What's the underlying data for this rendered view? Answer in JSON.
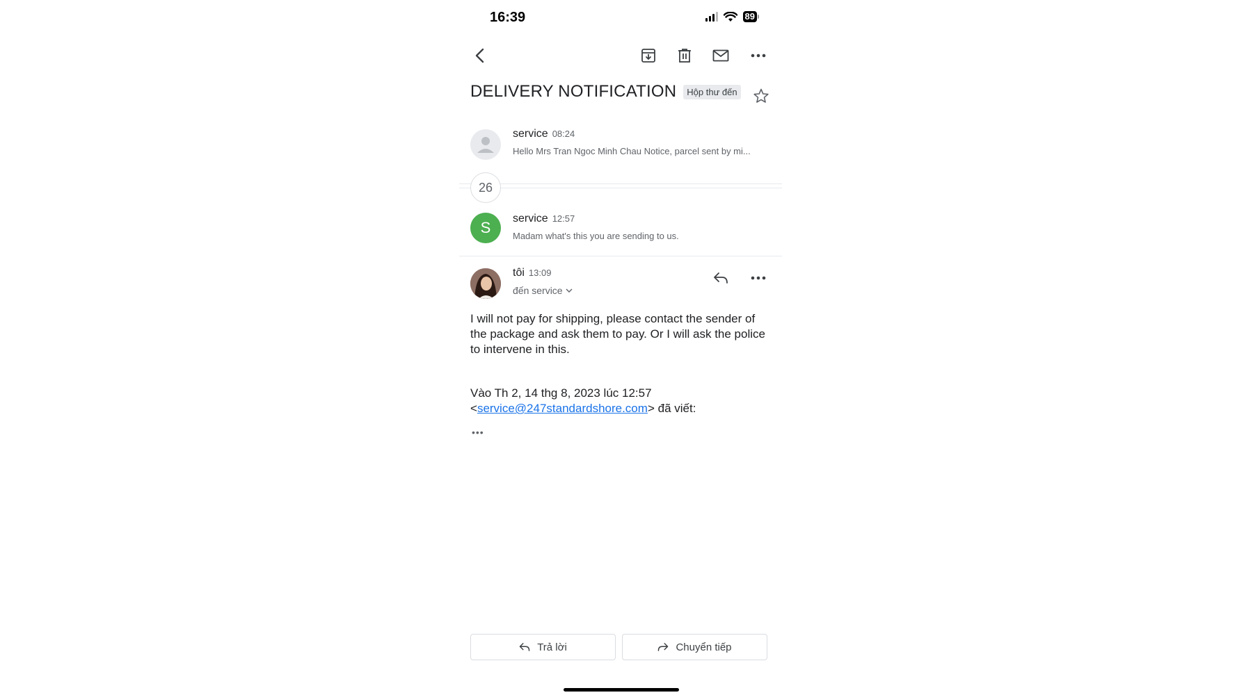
{
  "status": {
    "time": "16:39",
    "battery": "89"
  },
  "thread": {
    "subject": "DELIVERY NOTIFICATION",
    "label": "Hộp thư đến",
    "collapsed_count": "26"
  },
  "messages": [
    {
      "sender": "service",
      "time": "08:24",
      "snippet": "Hello Mrs Tran Ngoc Minh Chau Notice, parcel sent by mi..."
    },
    {
      "sender": "service",
      "time": "12:57",
      "snippet": "Madam what's this you are sending to us.",
      "avatar_letter": "S",
      "avatar_color": "#4caf50"
    },
    {
      "sender": "tôi",
      "time": "13:09",
      "recipient": "đến service",
      "body": "I will not pay for shipping, please contact the sender of the package and ask them to pay. Or I will ask the police to intervene in this.",
      "quote_line1": "Vào Th 2, 14 thg 8, 2023 lúc 12:57",
      "quote_email": "service@247standardshore.com",
      "quote_wrote": "đã viết:",
      "quote_open": "<",
      "quote_close": ">"
    }
  ],
  "actions": {
    "reply": "Trả lời",
    "forward": "Chuyển tiếp"
  },
  "icons": {
    "back": "chevron-left-icon",
    "archive": "archive-icon",
    "delete": "trash-icon",
    "mark_unread": "mail-icon",
    "more": "more-horizontal-icon",
    "star": "star-icon",
    "reply": "reply-icon",
    "forward": "forward-icon"
  },
  "colors": {
    "link": "#1a73e8",
    "green_avatar": "#4caf50"
  }
}
